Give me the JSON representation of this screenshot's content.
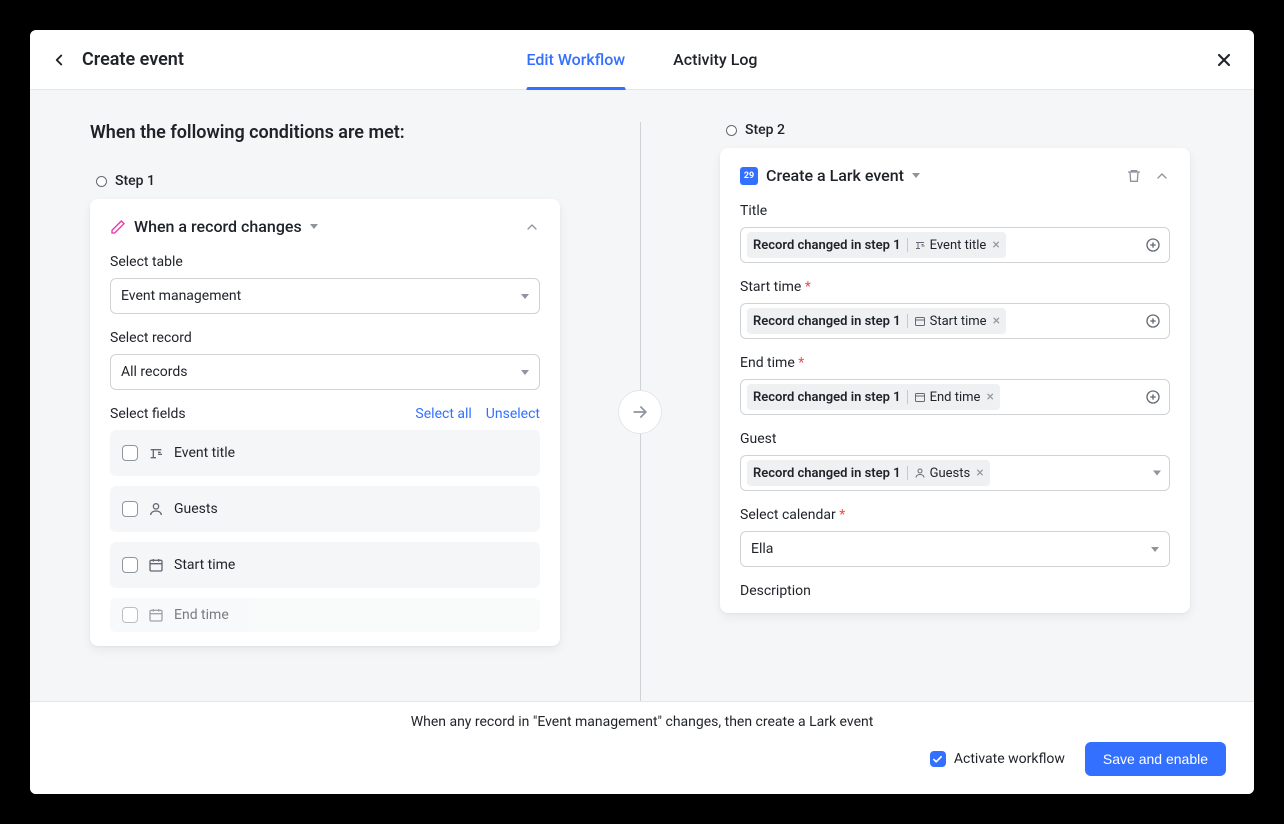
{
  "header": {
    "title": "Create event",
    "tabs": {
      "edit": "Edit Workflow",
      "activity": "Activity Log"
    }
  },
  "canvas": {
    "conditions_title": "When the following conditions are met:",
    "step1": {
      "label": "Step 1",
      "card_title": "When a record changes",
      "select_table_label": "Select table",
      "select_table_value": "Event management",
      "select_record_label": "Select record",
      "select_record_value": "All records",
      "select_fields_label": "Select fields",
      "select_all": "Select all",
      "unselect": "Unselect",
      "fields": [
        {
          "name": "Event title",
          "icon": "text"
        },
        {
          "name": "Guests",
          "icon": "person"
        },
        {
          "name": "Start time",
          "icon": "calendar"
        },
        {
          "name": "End time",
          "icon": "calendar"
        }
      ]
    },
    "step2": {
      "label": "Step 2",
      "card_title": "Create a Lark event",
      "lark_badge": "29",
      "fields": {
        "title": {
          "label": "Title",
          "token_prim": "Record changed in step 1",
          "token_sec": "Event title",
          "token_icon": "text"
        },
        "start_time": {
          "label": "Start time",
          "required": true,
          "token_prim": "Record changed in step 1",
          "token_sec": "Start time",
          "token_icon": "calendar"
        },
        "end_time": {
          "label": "End time",
          "required": true,
          "token_prim": "Record changed in step 1",
          "token_sec": "End time",
          "token_icon": "calendar"
        },
        "guest": {
          "label": "Guest",
          "token_prim": "Record changed in step 1",
          "token_sec": "Guests",
          "token_icon": "person",
          "dropdown": true
        },
        "calendar": {
          "label": "Select calendar",
          "required": true,
          "value": "Ella"
        },
        "description": {
          "label": "Description"
        }
      }
    }
  },
  "footer": {
    "summary": "When any record in \"Event management\" changes, then create a Lark event",
    "activate": "Activate workflow",
    "save": "Save and enable"
  }
}
